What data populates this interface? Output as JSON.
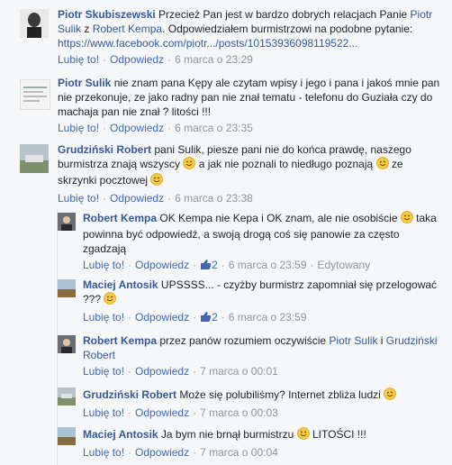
{
  "comments": [
    {
      "author": "Piotr Skubiszewski",
      "text_before": "Przecież Pan jest w bardzo dobrych relacjach Panie ",
      "mention1": "Piotr Sulik",
      "text_mid": " z ",
      "mention2": "Robert Kempa",
      "text_after": ". Odpowiedziałem burmistrzowi na podobne pytanie: ",
      "url": "https://www.facebook.com/piotr.../posts/10153936098119522...",
      "like": "Lubię to!",
      "reply": "Odpowiedz",
      "time": "6 marca o 23:29"
    },
    {
      "author": "Piotr Sulik",
      "text": "nie znam pana Kępy ale czytam wpisy i jego i pana i jakoś mnie pan nie przekonuje, ze jako radny pan nie znał tematu - telefonu do Guziała czy do machaja pan nie znał ? litości !!!",
      "like": "Lubię to!",
      "reply": "Odpowiedz",
      "time": "6 marca o 23:35"
    },
    {
      "author": "Grudziński Robert",
      "text_before": "pani Sulik, piesze pani nie do końca prawdę, naszego burmistrza znają wszyscy ",
      "text_mid": " a jak nie poznali to niedługo poznają ",
      "text_after": " ze skrzynki pocztowej ",
      "like": "Lubię to!",
      "reply": "Odpowiedz",
      "time": "6 marca o 23:38"
    }
  ],
  "replies": [
    {
      "author": "Robert Kempa",
      "text_before": "OK Kempa nie Kepa i OK znam, ale nie osobiście ",
      "text_after": " taka powinna być odpowiedź, a swoją drogą coś się panowie za często zgadzają",
      "like": "Lubię to!",
      "reply": "Odpowiedz",
      "likes_count": "2",
      "time": "6 marca o 23:59",
      "edited": "Edytowany"
    },
    {
      "author": "Maciej Antosik",
      "text_before": "UPSSSS... - czyżby burmistrz zapomniał się przelogować ??? ",
      "like": "Lubię to!",
      "reply": "Odpowiedz",
      "likes_count": "2",
      "time": "6 marca o 23:59"
    },
    {
      "author": "Robert Kempa",
      "text_before": "przez panów rozumiem oczywiście ",
      "mention1": "Piotr Sulik",
      "text_mid": " i ",
      "mention2": "Grudziński Robert",
      "like": "Lubię to!",
      "reply": "Odpowiedz",
      "time": "7 marca o 00:01"
    },
    {
      "author": "Grudziński Robert",
      "text_before": "Może się polubiliśmy? Internet zbliża ludzi ",
      "like": "Lubię to!",
      "reply": "Odpowiedz",
      "time": "7 marca o 00:03"
    },
    {
      "author": "Maciej Antosik",
      "text_before": "Ja bym nie brnął burmistrzu ",
      "text_after": " LITOŚCI !!!",
      "like": "Lubię to!",
      "reply": "Odpowiedz",
      "time": "7 marca o 00:04"
    }
  ],
  "colors": {
    "link": "#365899",
    "action": "#4267b2",
    "meta": "#90949c",
    "emoji": "#f7c843"
  },
  "icons": [
    "smile-emoji-icon",
    "thumbs-up-icon"
  ]
}
